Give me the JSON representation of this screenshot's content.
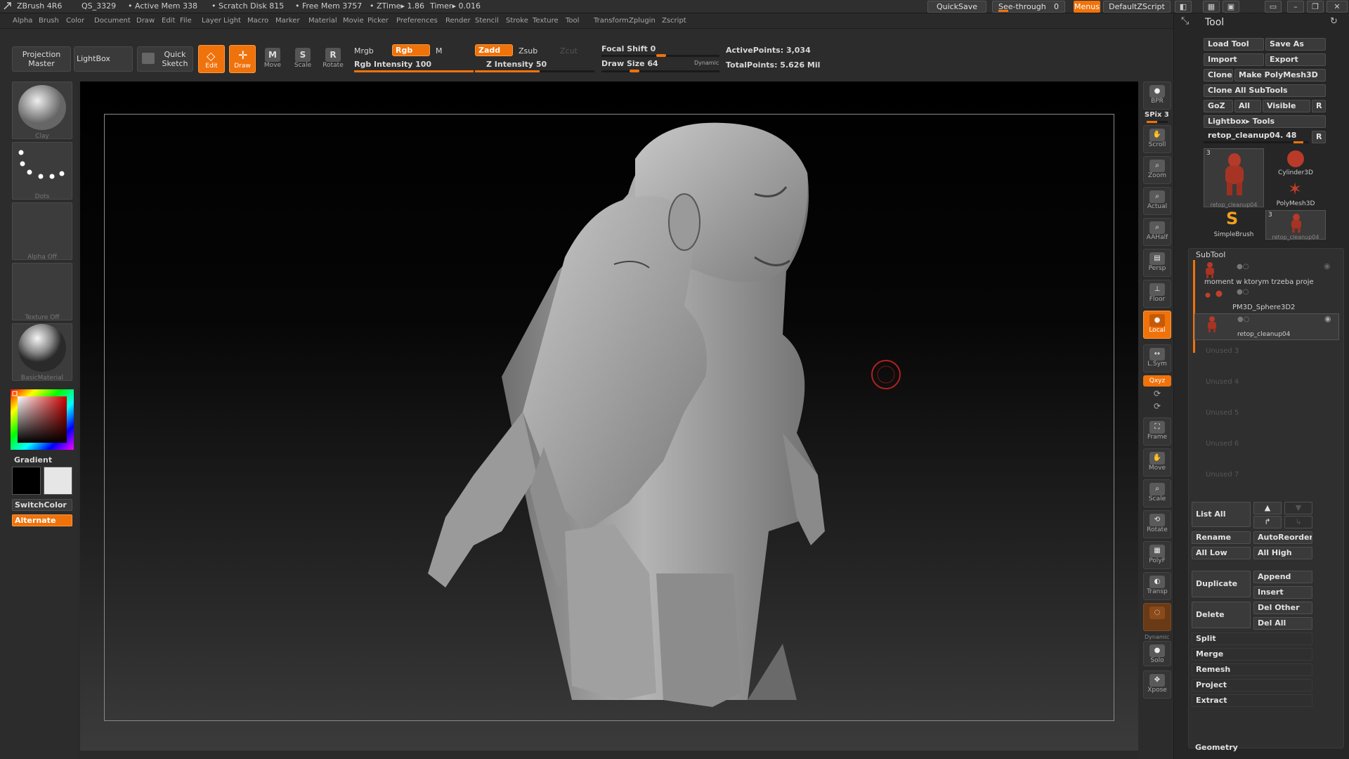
{
  "title_bar": {
    "app": "ZBrush 4R6",
    "doc": "QS_3329",
    "active_mem": "• Active Mem 338",
    "scratch": "• Scratch Disk 815",
    "free_mem": "• Free Mem 3757",
    "ztime": "• ZTime▸ 1.86",
    "timer": "Timer▸ 0.016",
    "quicksave": "QuickSave",
    "see_through": "See-through",
    "see_through_val": "0",
    "menus": "Menus",
    "default_script": "DefaultZScript"
  },
  "menu": {
    "items": [
      "Alpha",
      "Brush",
      "Color",
      "Document",
      "Draw",
      "Edit",
      "File",
      "Layer",
      "Light",
      "Macro",
      "Marker",
      "Material",
      "Movie",
      "Picker",
      "Preferences",
      "Render",
      "Stencil",
      "Stroke",
      "Texture",
      "Tool",
      "Transform",
      "Zplugin",
      "Zscript"
    ]
  },
  "toolbar": {
    "projection_master": "Projection Master",
    "lightbox": "LightBox",
    "quick_sketch": "Quick Sketch",
    "edit": "Edit",
    "draw": "Draw",
    "move": "Move",
    "scale": "Scale",
    "rotate": "Rotate",
    "mrgb": "Mrgb",
    "rgb": "Rgb",
    "m": "M",
    "rgb_intensity": "Rgb Intensity 100",
    "zadd": "Zadd",
    "zsub": "Zsub",
    "zcut": "Zcut",
    "z_intensity": "Z Intensity 50",
    "focal_shift": "Focal Shift 0",
    "draw_size": "Draw Size 64",
    "dynamic": "Dynamic",
    "active_points": "ActivePoints: 3,034",
    "total_points": "TotalPoints: 5.626 Mil"
  },
  "left_shelf": {
    "clay": "Clay",
    "dots": "Dots",
    "alpha_off": "Alpha Off",
    "texture_off": "Texture Off",
    "basic_material": "BasicMaterial",
    "gradient": "Gradient",
    "switch_color": "SwitchColor",
    "alternate": "Alternate"
  },
  "right_shelf": {
    "bpr": "BPR",
    "spix": "SPix 3",
    "scroll": "Scroll",
    "zoom": "Zoom",
    "actual": "Actual",
    "aahalf": "AAHalf",
    "persp": "Persp",
    "floor": "Floor",
    "local": "Local",
    "lsym": "L.Sym",
    "xyz": "Qxyz",
    "frame": "Frame",
    "move": "Move",
    "scale": "Scale",
    "rotate": "Rotate",
    "polyf": "PolyF",
    "transp": "Transp",
    "dynamic": "Dynamic",
    "solo": "Solo",
    "xpose": "Xpose"
  },
  "tool_panel": {
    "title": "Tool",
    "load_tool": "Load Tool",
    "save_as": "Save As",
    "import": "Import",
    "export": "Export",
    "clone": "Clone",
    "make_polymesh": "Make PolyMesh3D",
    "clone_all": "Clone All SubTools",
    "goz": "GoZ",
    "all": "All",
    "visible": "Visible",
    "r": "R",
    "lightbox_tools": "Lightbox▸ Tools",
    "current_tool": "retop_cleanup04. 48",
    "thumbs": [
      {
        "label": "retop_cleanup04",
        "badge": "3"
      },
      {
        "label": "Cylinder3D"
      },
      {
        "label": "PolyMesh3D"
      },
      {
        "label": "SimpleBrush"
      },
      {
        "label": "retop_cleanup04",
        "badge": "3"
      }
    ],
    "subtool_title": "SubTool",
    "subtools": [
      {
        "name": "moment w ktorym trzeba proje"
      },
      {
        "name": "PM3D_Sphere3D2"
      },
      {
        "name": "retop_cleanup04"
      }
    ],
    "unused": [
      "Unused 3",
      "Unused 4",
      "Unused 5",
      "Unused 6",
      "Unused 7"
    ],
    "list_all": "List All",
    "rename": "Rename",
    "autoreorder": "AutoReorder",
    "all_low": "All Low",
    "all_high": "All High",
    "duplicate": "Duplicate",
    "append": "Append",
    "insert": "Insert",
    "delete": "Delete",
    "del_other": "Del Other",
    "del_all": "Del All",
    "split": "Split",
    "merge": "Merge",
    "remesh": "Remesh",
    "project": "Project",
    "extract": "Extract",
    "geometry": "Geometry"
  },
  "colors": {
    "accent": "#f0720b",
    "panel": "#262626",
    "clay_red": "#b43a2a"
  }
}
